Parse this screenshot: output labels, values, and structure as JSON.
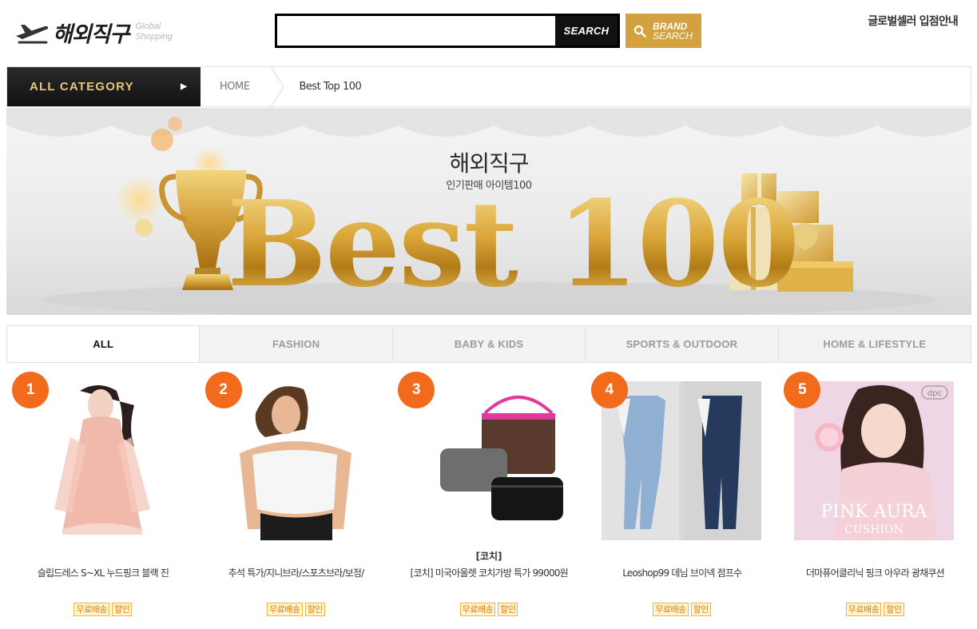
{
  "header": {
    "logo_text": "해외직구",
    "logo_sub_1": "Global",
    "logo_sub_2": "Shopping",
    "search_placeholder": "",
    "search_button": "SEARCH",
    "brand_search_1": "BRAND",
    "brand_search_2": "SEARCH",
    "seller_link": "글로벌셀러 입점안내"
  },
  "nav": {
    "all_category": "ALL CATEGORY",
    "breadcrumb": [
      "HOME",
      "Best Top 100"
    ]
  },
  "banner": {
    "title": "해외직구",
    "subtitle": "인기판매 아이템100",
    "big_text": "Best 100"
  },
  "tabs": [
    {
      "label": "ALL",
      "active": true
    },
    {
      "label": "FASHION",
      "active": false
    },
    {
      "label": "BABY & KIDS",
      "active": false
    },
    {
      "label": "SPORTS & OUTDOOR",
      "active": false
    },
    {
      "label": "HOME & LIFESTYLE",
      "active": false
    }
  ],
  "products": [
    {
      "rank": "1",
      "brand": "",
      "name": "슬립드레스 S~XL 누드핑크 블랙 진",
      "badges": [
        "무료배송",
        "할인"
      ]
    },
    {
      "rank": "2",
      "brand": "",
      "name": "추석 특가/지니브라/스포츠브라/보정/",
      "badges": [
        "무료배송",
        "할인"
      ]
    },
    {
      "rank": "3",
      "brand": "[코치]",
      "name": "[코치] 미국아울렛 코치가방 특가 99000원",
      "badges": [
        "무료배송",
        "할인"
      ]
    },
    {
      "rank": "4",
      "brand": "",
      "name": "Leoshop99 데님 브이넥 점프수",
      "badges": [
        "무료배송",
        "할인"
      ]
    },
    {
      "rank": "5",
      "brand": "",
      "name": "더마퓨어클리닉 핑크 아우라 광채쿠션",
      "badges": [
        "무료배송",
        "할인"
      ]
    }
  ],
  "product_image_text": {
    "p5_brand": "dpc",
    "p5_line1": "PINK AURA",
    "p5_line2": "CUSHION"
  },
  "colors": {
    "rank_badge": "#f26a1b",
    "brand_search_bg": "#d3a23e",
    "all_category_text": "#e6c67d",
    "badge_text": "#e07b12"
  }
}
